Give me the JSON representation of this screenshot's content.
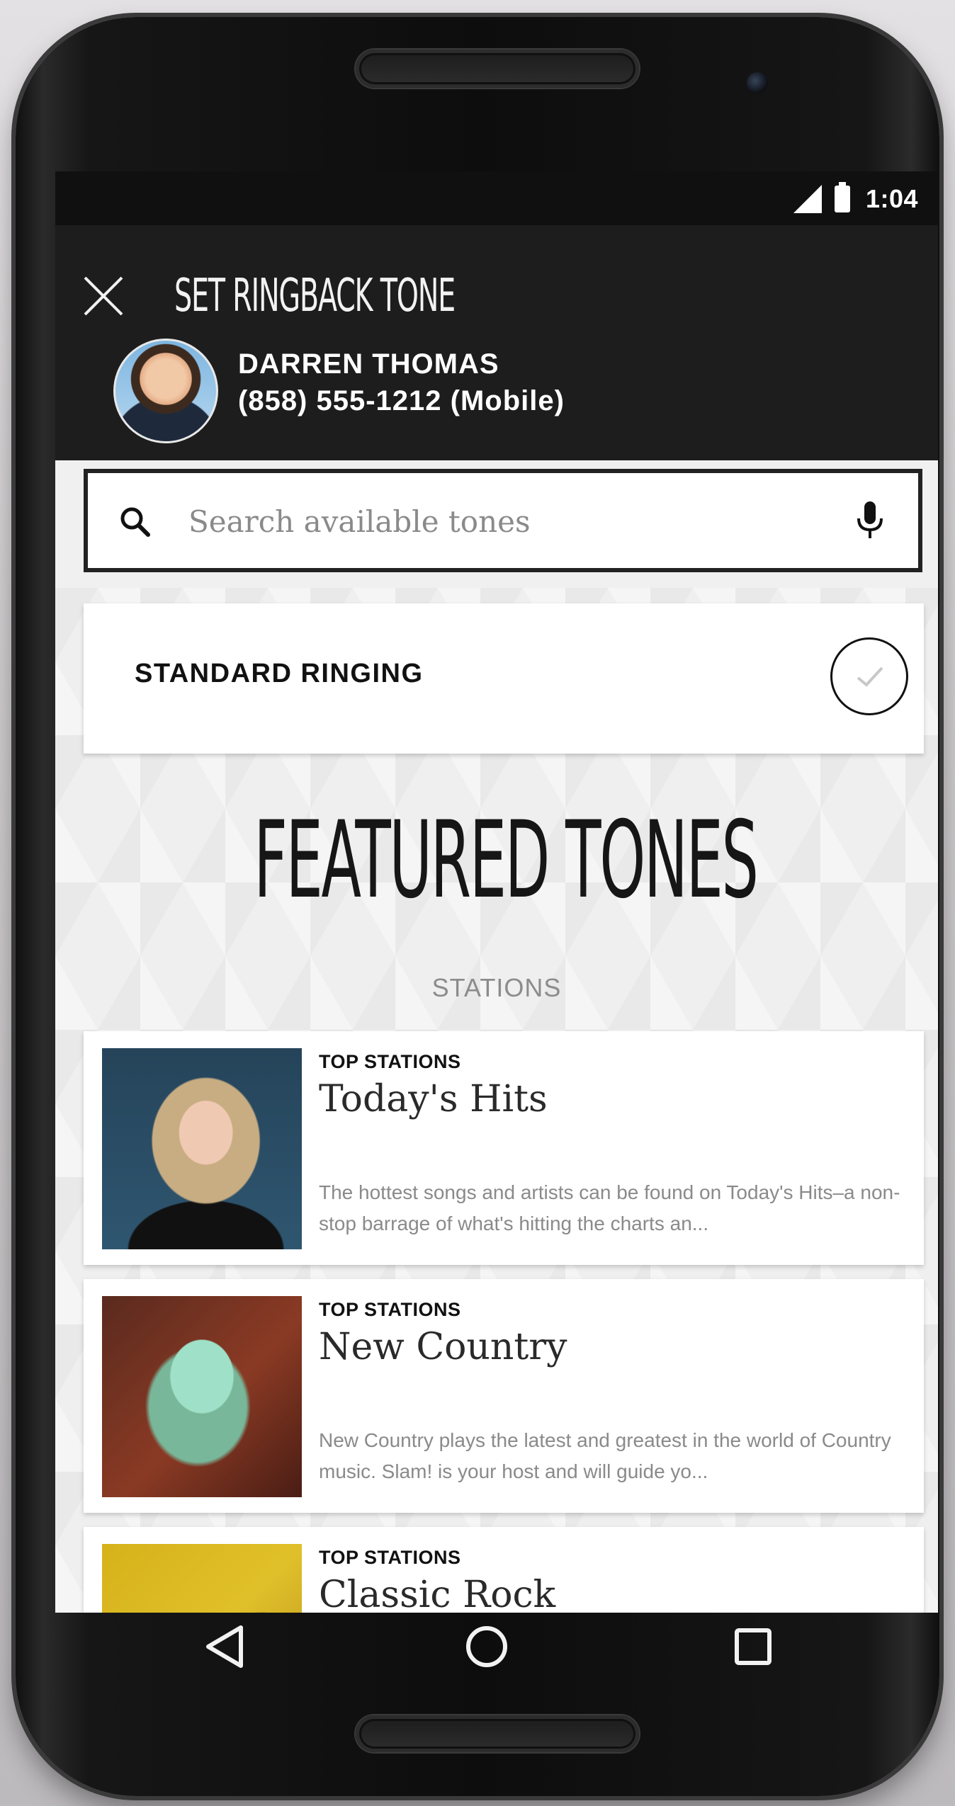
{
  "status_bar": {
    "time": "1:04",
    "icons": [
      "signal-icon",
      "battery-icon"
    ]
  },
  "header": {
    "title": "SET RINGBACK TONE",
    "close_icon": "close-icon"
  },
  "contact": {
    "name": "DARREN THOMAS",
    "phone": "(858) 555-1212 (Mobile)"
  },
  "search": {
    "placeholder": "Search available tones",
    "value": ""
  },
  "standard": {
    "label": "STANDARD RINGING",
    "selected": true
  },
  "featured": {
    "title": "FEATURED TONES",
    "section_label": "STATIONS"
  },
  "stations": [
    {
      "kicker": "TOP STATIONS",
      "name": "Today's Hits",
      "description": "The hottest songs and artists can be found on Today's Hits–a non-stop barrage of what's hitting the charts an..."
    },
    {
      "kicker": "TOP STATIONS",
      "name": "New Country",
      "description": "New Country plays the latest and greatest in the world of Country music. Slam! is your host and will guide yo..."
    },
    {
      "kicker": "TOP STATIONS",
      "name": "Classic Rock",
      "description": ""
    }
  ],
  "nav": {
    "back_icon": "back-triangle-icon",
    "home_icon": "home-circle-icon",
    "recents_icon": "recents-square-icon"
  },
  "colors": {
    "header_bg": "#1d1d1d",
    "status_bg": "#101010",
    "content_bg": "#efefef",
    "card_bg": "#ffffff"
  }
}
